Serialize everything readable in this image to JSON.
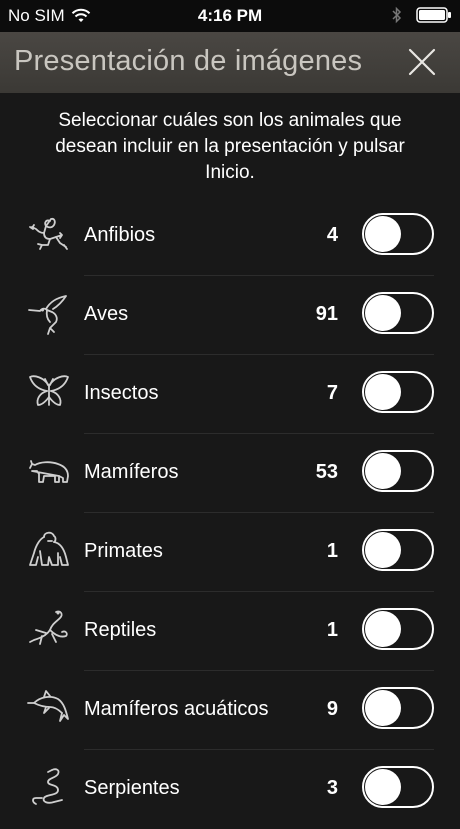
{
  "status": {
    "carrier": "No SIM",
    "time": "4:16 PM"
  },
  "header": {
    "title": "Presentación de imágenes"
  },
  "instructions": "Seleccionar cuáles son los animales que desean incluir en la presentación y pulsar Inicio.",
  "categories": [
    {
      "label": "Anfibios",
      "count": "4",
      "icon": "frog-icon",
      "enabled": false
    },
    {
      "label": "Aves",
      "count": "91",
      "icon": "hummingbird-icon",
      "enabled": false
    },
    {
      "label": "Insectos",
      "count": "7",
      "icon": "butterfly-icon",
      "enabled": false
    },
    {
      "label": "Mamíferos",
      "count": "53",
      "icon": "bear-icon",
      "enabled": false
    },
    {
      "label": "Primates",
      "count": "1",
      "icon": "gorilla-icon",
      "enabled": false
    },
    {
      "label": "Reptiles",
      "count": "1",
      "icon": "lizard-icon",
      "enabled": false
    },
    {
      "label": "Mamíferos acuáticos",
      "count": "9",
      "icon": "dolphin-icon",
      "enabled": false
    },
    {
      "label": "Serpientes",
      "count": "3",
      "icon": "snake-icon",
      "enabled": false
    }
  ]
}
